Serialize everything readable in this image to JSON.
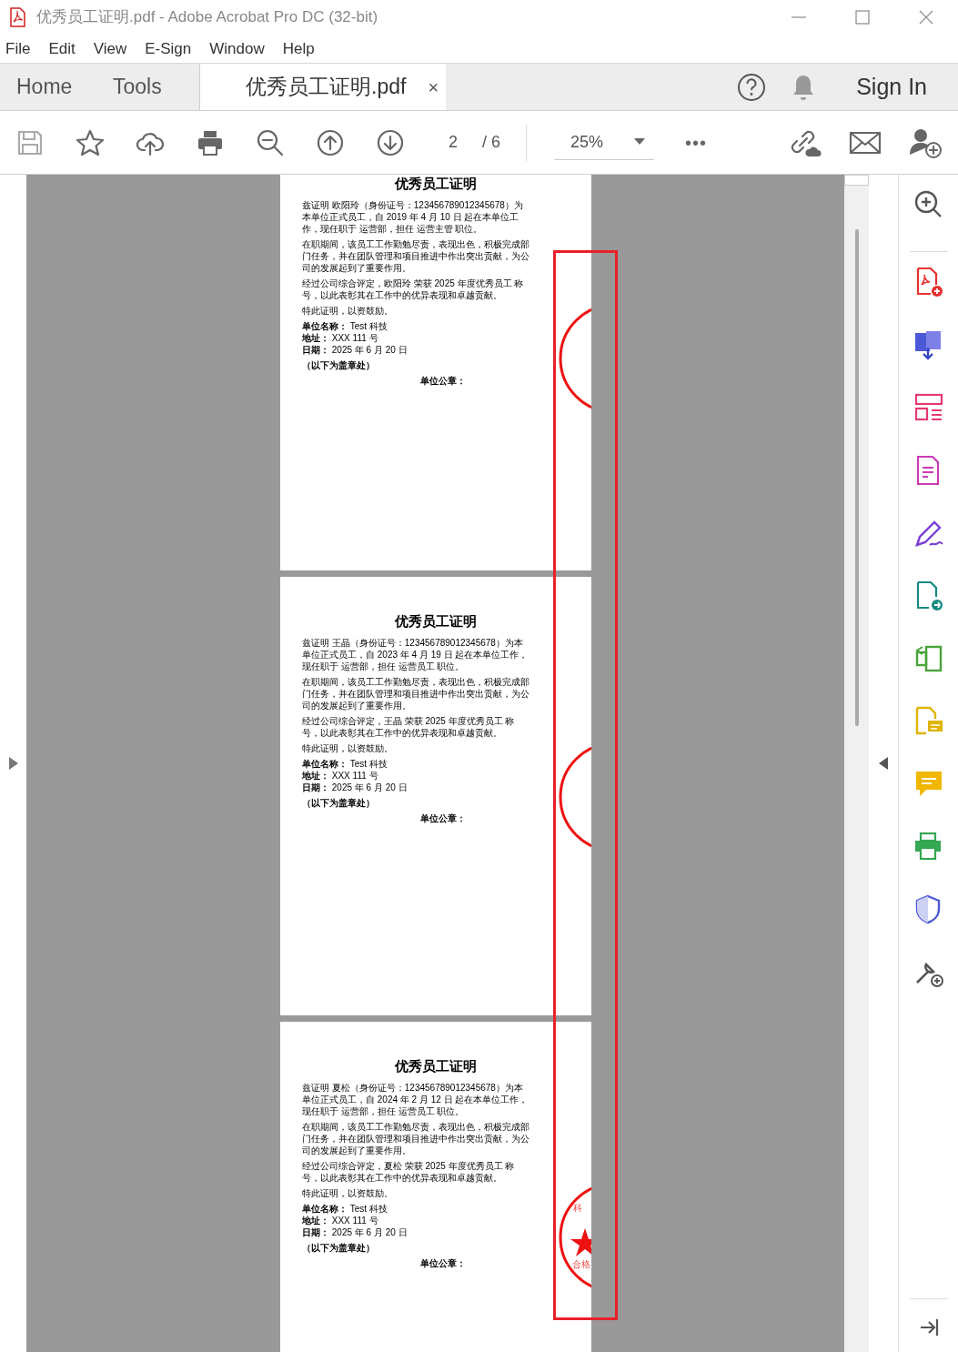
{
  "window": {
    "title": "优秀员工证明.pdf - Adobe Acrobat Pro DC (32-bit)"
  },
  "menu": [
    "File",
    "Edit",
    "View",
    "E-Sign",
    "Window",
    "Help"
  ],
  "tabs": [
    {
      "label": "Home",
      "selected": false
    },
    {
      "label": "Tools",
      "selected": false
    },
    {
      "label": "优秀员工证明.pdf",
      "selected": true,
      "close": "×"
    }
  ],
  "header": {
    "sign_in": "Sign In"
  },
  "toolbar": {
    "page_number": "2",
    "page_count": "/ 6",
    "zoom": "25%",
    "more": "•••"
  },
  "pages": [
    {
      "title": "优秀员工证明",
      "paragraphs": [
        "兹证明 欧阳玲（身份证号：123456789012345678）为本单位正式员工，自 2019 年 4 月 10 日 起在本单位工作，现任职于 运营部，担任 运营主管 职位。",
        "在职期间，该员工工作勤勉尽责，表现出色，积极完成部门任务，并在团队管理和项目推进中作出突出贡献，为公司的发展起到了重要作用。",
        "经过公司综合评定，欧阳玲 荣获 2025 年度优秀员工 称号，以此表彰其在工作中的优异表现和卓越贡献。",
        "特此证明，以资鼓励。"
      ],
      "fields": [
        "**单位名称：** Test 科技",
        "**地址：** XXX 111 号",
        "**日期：** 2025 年 6 月 20 日"
      ],
      "seal_note": "（以下为盖章处）",
      "seal_label": "单位公章："
    },
    {
      "title": "优秀员工证明",
      "paragraphs": [
        "兹证明 王晶（身份证号：123456789012345678）为本单位正式员工，自 2023 年 4 月 19 日 起在本单位工作，现任职于 运营部，担任 运营员工 职位。",
        "在职期间，该员工工作勤勉尽责，表现出色，积极完成部门任务，并在团队管理和项目推进中作出突出贡献，为公司的发展起到了重要作用。",
        "经过公司综合评定，王晶 荣获 2025 年度优秀员工 称号，以此表彰其在工作中的优异表现和卓越贡献。",
        "特此证明，以资鼓励。"
      ],
      "fields": [
        "**单位名称：** Test 科技",
        "**地址：** XXX 111 号",
        "**日期：** 2025 年 6 月 20 日"
      ],
      "seal_note": "（以下为盖章处）",
      "seal_label": "单位公章："
    },
    {
      "title": "优秀员工证明",
      "paragraphs": [
        "兹证明 夏松（身份证号：123456789012345678）为本单位正式员工，自 2024 年 2 月 12 日 起在本单位工作，现任职于 运营部，担任 运营员工 职位。",
        "在职期间，该员工工作勤勉尽责，表现出色，积极完成部门任务，并在团队管理和项目推进中作出突出贡献，为公司的发展起到了重要作用。",
        "经过公司综合评定，夏松 荣获 2025 年度优秀员工 称号，以此表彰其在工作中的优异表现和卓越贡献。",
        "特此证明，以资鼓励。"
      ],
      "fields": [
        "**单位名称：** Test 科技",
        "**地址：** XXX 111 号",
        "**日期：** 2025 年 6 月 20 日"
      ],
      "seal_note": "（以下为盖章处）",
      "seal_label": "单位公章：",
      "stamp_texts": [
        "科",
        "合格"
      ]
    }
  ]
}
